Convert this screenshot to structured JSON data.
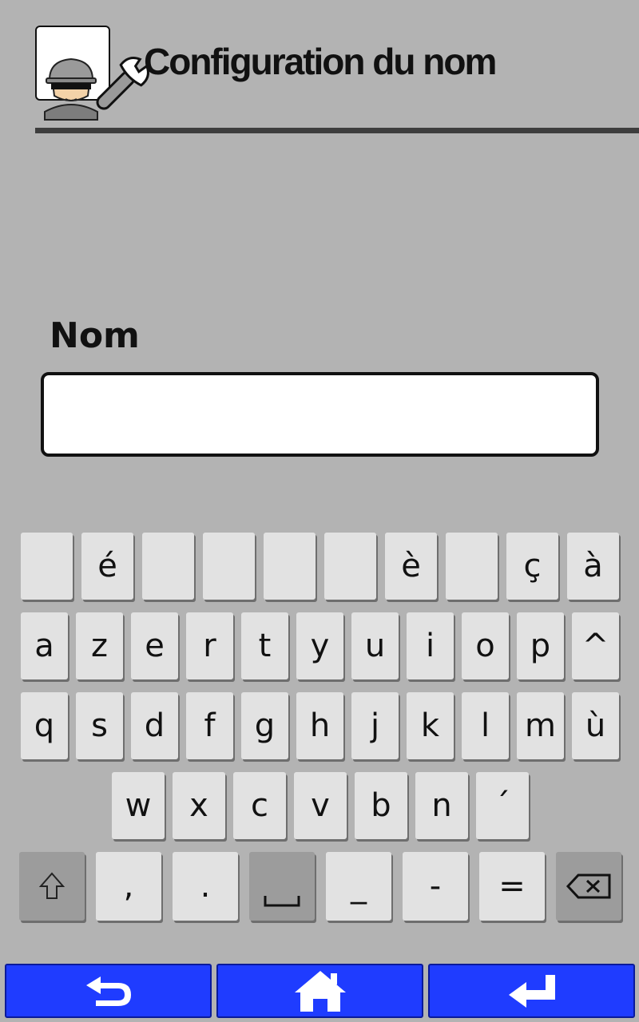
{
  "header": {
    "title": "Configuration du nom",
    "icon": "user-settings-icon"
  },
  "form": {
    "label": "Nom",
    "value": "",
    "placeholder": ""
  },
  "keyboard": {
    "rows": [
      [
        "",
        "é",
        "",
        "",
        "",
        "",
        "è",
        "",
        "ç",
        "à"
      ],
      [
        "a",
        "z",
        "e",
        "r",
        "t",
        "y",
        "u",
        "i",
        "o",
        "p",
        "^"
      ],
      [
        "q",
        "s",
        "d",
        "f",
        "g",
        "h",
        "j",
        "k",
        "l",
        "m",
        "ù"
      ],
      [
        "w",
        "x",
        "c",
        "v",
        "b",
        "n",
        "´"
      ],
      [
        "shift-icon",
        ",",
        ".",
        "space-icon",
        "_",
        "-",
        "=",
        "backspace-icon"
      ]
    ]
  },
  "nav": {
    "buttons": [
      "back-icon",
      "home-icon",
      "enter-icon"
    ]
  },
  "colors": {
    "background": "#b3b3b3",
    "key": "#e2e2e2",
    "key_dark": "#9c9c9c",
    "nav_button": "#1f3cff"
  }
}
